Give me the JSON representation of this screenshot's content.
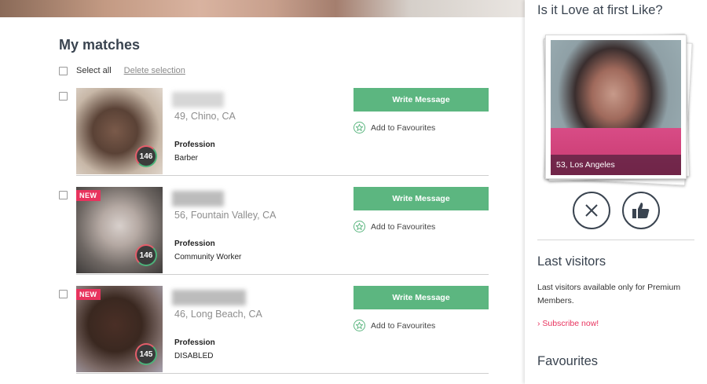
{
  "main": {
    "title": "My matches",
    "select_all": "Select all",
    "delete_selection": "Delete selection",
    "profession_label": "Profession",
    "write_message": "Write Message",
    "add_favourites": "Add to Favourites",
    "matches": [
      {
        "location": "49, Chino, CA",
        "profession": "Barber",
        "score": "146",
        "new": ""
      },
      {
        "location": "56, Fountain Valley, CA",
        "profession": "Community Worker",
        "score": "146",
        "new": "NEW"
      },
      {
        "location": "46, Long Beach, CA",
        "profession": "DISABLED",
        "score": "145",
        "new": "NEW"
      }
    ]
  },
  "sidebar": {
    "love_title": "Is it Love at first Like?",
    "card_caption": "53, Los Angeles",
    "last_visitors_title": "Last visitors",
    "last_visitors_text": "Last visitors available only for Premium Members.",
    "subscribe": "Subscribe now!",
    "favourites_title": "Favourites"
  },
  "colors": {
    "accent_green": "#5cb680",
    "badge_pink": "#e8335e",
    "heading": "#3a4450"
  }
}
